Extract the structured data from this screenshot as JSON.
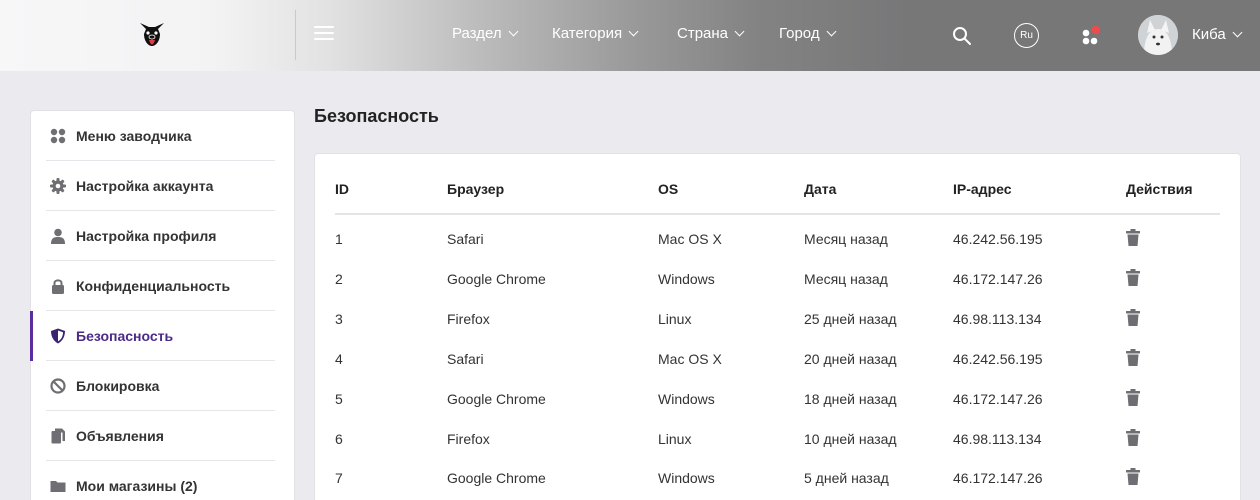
{
  "header": {
    "nav": [
      {
        "label": "Раздел"
      },
      {
        "label": "Категория"
      },
      {
        "label": "Страна"
      },
      {
        "label": "Город"
      }
    ],
    "lang": "Ru",
    "user_name": "Киба"
  },
  "sidebar": {
    "items": [
      {
        "label": "Меню заводчика",
        "icon": "dots-grid-icon"
      },
      {
        "label": "Настройка аккаунта",
        "icon": "gear-icon"
      },
      {
        "label": "Настройка профиля",
        "icon": "user-icon"
      },
      {
        "label": "Конфиденциальность",
        "icon": "lock-icon"
      },
      {
        "label": "Безопасность",
        "icon": "shield-icon",
        "active": true
      },
      {
        "label": "Блокировка",
        "icon": "block-icon"
      },
      {
        "label": "Объявления",
        "icon": "documents-icon"
      },
      {
        "label": "Мои магазины (2)",
        "icon": "folder-icon"
      }
    ]
  },
  "main": {
    "title": "Безопасность",
    "table": {
      "columns": [
        "ID",
        "Браузер",
        "OS",
        "Дата",
        "IP-адрес",
        "Действия"
      ],
      "rows": [
        [
          "1",
          "Safari",
          "Mac OS X",
          "Месяц назад",
          "46.242.56.195"
        ],
        [
          "2",
          "Google Chrome",
          "Windows",
          "Месяц назад",
          "46.172.147.26"
        ],
        [
          "3",
          "Firefox",
          "Linux",
          "25 дней назад",
          "46.98.113.134"
        ],
        [
          "4",
          "Safari",
          "Mac OS X",
          "20 дней назад",
          "46.242.56.195"
        ],
        [
          "5",
          "Google Chrome",
          "Windows",
          "18 дней назад",
          "46.172.147.26"
        ],
        [
          "6",
          "Firefox",
          "Linux",
          "10 дней назад",
          "46.98.113.134"
        ],
        [
          "7",
          "Google Chrome",
          "Windows",
          "5 дней назад",
          "46.172.147.26"
        ]
      ]
    }
  },
  "colors": {
    "accent": "#5b2c9e",
    "notification": "#ef4b4b",
    "icon_gray": "#6f6f73"
  }
}
